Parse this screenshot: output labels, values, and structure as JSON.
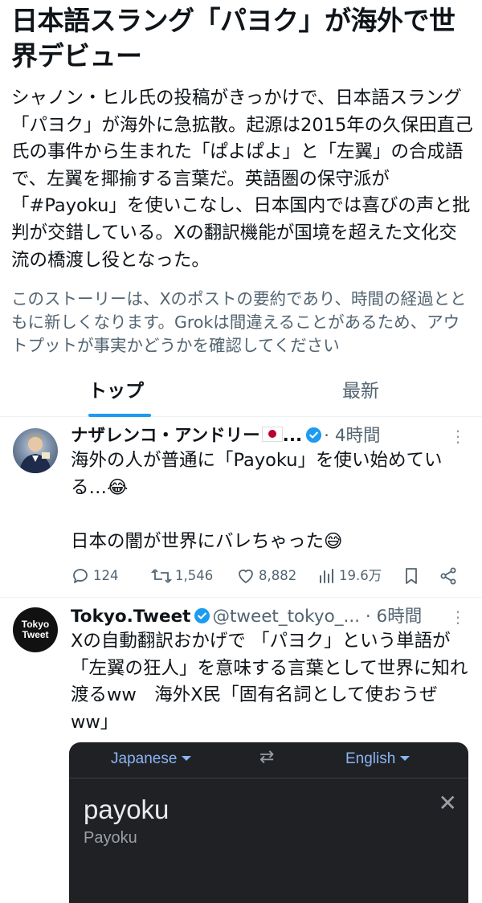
{
  "story": {
    "title": "日本語スラング「パヨク」が海外で世界デビュー",
    "summary": "シャノン・ヒル氏の投稿がきっかけで、日本語スラング「パヨク」が海外に急拡散。起源は2015年の久保田直己氏の事件から生まれた「ぱよぱよ」と「左翼」の合成語で、左翼を揶揄する言葉だ。英語圏の保守派が「#Payoku」を使いこなし、日本国内では喜びの声と批判が交錯している。Xの翻訳機能が国境を超えた文化交流の橋渡し役となった。",
    "disclaimer": "このストーリーは、Xのポストの要約であり、時間の経過とともに新しくなります。Grokは間違えることがあるため、アウトプットが事実かどうかを確認してください"
  },
  "tabs": {
    "top": "トップ",
    "latest": "最新"
  },
  "posts": [
    {
      "author": "ナザレンコ・アンドリー",
      "name_ellipsis": "...",
      "time": "· 4時間",
      "text": "海外の人が普通に「Payoku」を使い始めている…😂\n\n日本の闇が世界にバレちゃった😅",
      "replies": "124",
      "reposts": "1,546",
      "likes": "8,882",
      "views": "19.6万"
    },
    {
      "author": "Tokyo.Tweet",
      "handle": "@tweet_tokyo_...",
      "time": "· 6時間",
      "avatar_text_1": "Tokyo",
      "avatar_text_2": "Tweet",
      "text": "Xの自動翻訳おかげで 「パヨク」という単語が「左翼の狂人」を意味する言葉として世界に知れ渡るww　海外X民「固有名詞として使おうぜww」",
      "embed": {
        "source_lang": "Japanese",
        "target_lang": "English",
        "translation": "payoku",
        "transliteration": "Payoku"
      }
    }
  ],
  "colors": {
    "accent": "#1d9bf0",
    "muted": "#536471",
    "embed_bg": "#202124",
    "embed_link": "#8ab4f8"
  }
}
